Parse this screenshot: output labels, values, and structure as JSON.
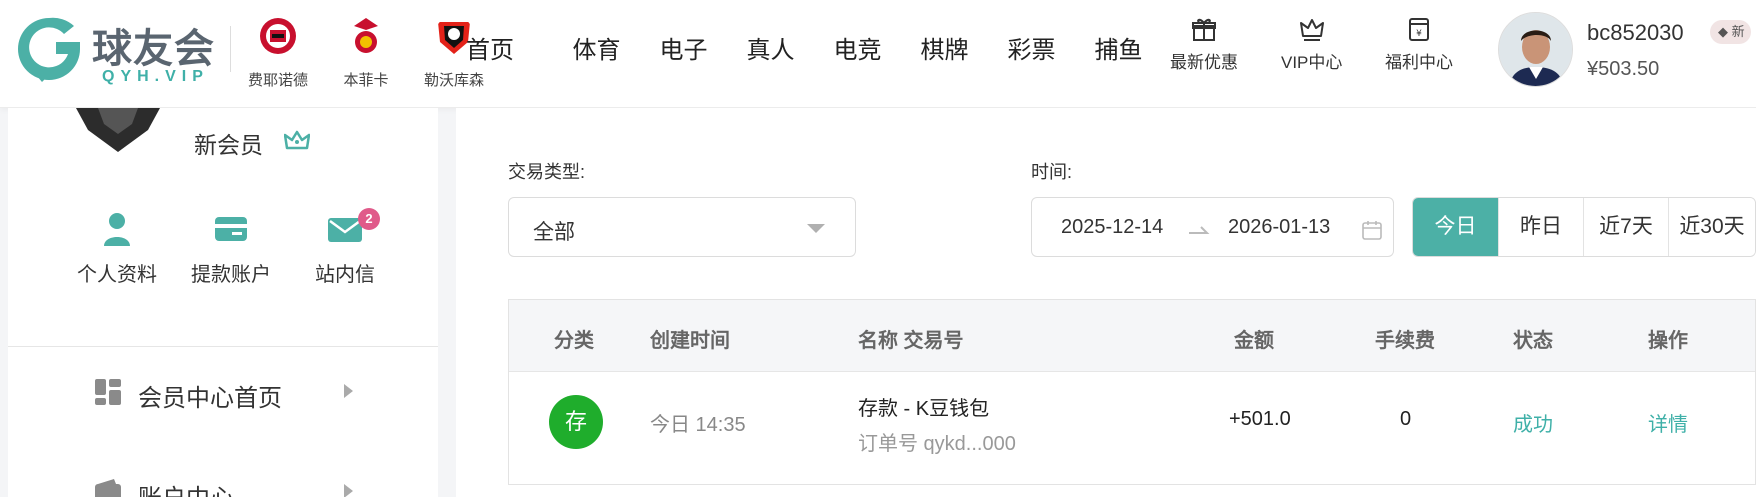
{
  "header": {
    "logo_text": "球友会",
    "logo_sub": "QYH.VIP",
    "clubs": [
      {
        "name": "费耶诺德"
      },
      {
        "name": "本菲卡"
      },
      {
        "name": "勒沃库森"
      }
    ],
    "nav": [
      "首页",
      "体育",
      "电子",
      "真人",
      "电竞",
      "棋牌",
      "彩票",
      "捕鱼"
    ],
    "quick_links": [
      {
        "label": "最新优惠",
        "icon": "gift-icon"
      },
      {
        "label": "VIP中心",
        "icon": "crown-icon"
      },
      {
        "label": "福利中心",
        "icon": "wallet-yen-icon"
      }
    ],
    "user": {
      "name": "bc852030",
      "balance": "¥503.50",
      "tag": "新"
    }
  },
  "sidebar": {
    "member_level": "新会员",
    "icons": [
      {
        "label": "个人资料",
        "icon": "user-icon"
      },
      {
        "label": "提款账户",
        "icon": "card-icon"
      },
      {
        "label": "站内信",
        "icon": "mail-icon",
        "badge": "2"
      }
    ],
    "menu": [
      {
        "label": "会员中心首页",
        "icon": "dashboard-icon"
      },
      {
        "label": "账户中心",
        "icon": "wallet-icon"
      }
    ]
  },
  "filters": {
    "type_label": "交易类型:",
    "type_value": "全部",
    "time_label": "时间:",
    "date_start": "2025-12-14",
    "date_end": "2026-01-13",
    "ranges": [
      {
        "label": "今日",
        "active": true
      },
      {
        "label": "昨日",
        "active": false
      },
      {
        "label": "近7天",
        "active": false
      },
      {
        "label": "近30天",
        "active": false
      }
    ]
  },
  "table": {
    "headers": [
      "分类",
      "创建时间",
      "名称 交易号",
      "金额",
      "手续费",
      "状态",
      "操作"
    ],
    "rows": [
      {
        "category": "存",
        "created": "今日 14:35",
        "name": "存款 - K豆钱包",
        "order": "订单号 qykd...000",
        "amount": "+501.0",
        "fee": "0",
        "status": "成功",
        "action": "详情"
      }
    ]
  },
  "colors": {
    "accent": "#4cb0a6",
    "deposit_badge": "#1fad2c",
    "msg_badge": "#e05a8a"
  }
}
